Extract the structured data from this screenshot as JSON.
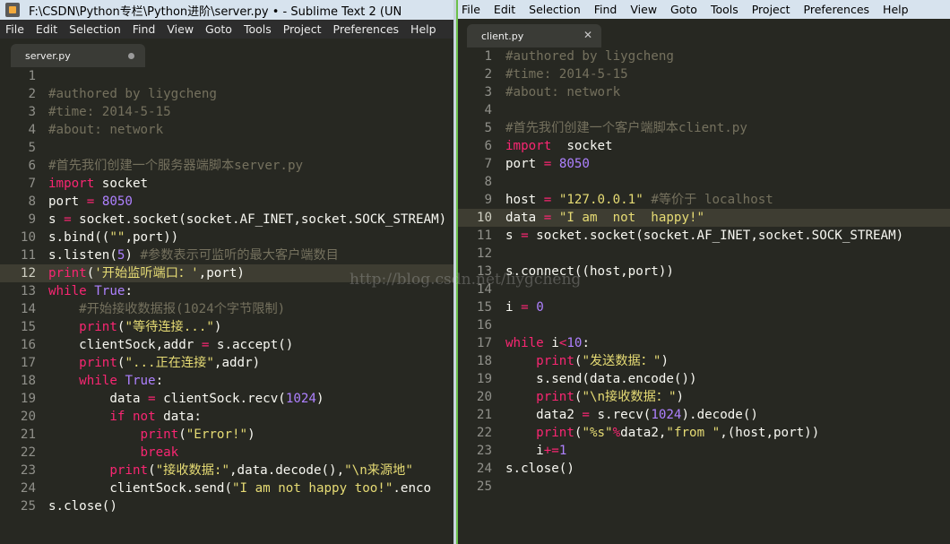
{
  "left_window": {
    "title": "F:\\CSDN\\Python专栏\\Python进阶\\server.py • - Sublime Text 2 (UN",
    "menu": [
      "File",
      "Edit",
      "Selection",
      "Find",
      "View",
      "Goto",
      "Tools",
      "Project",
      "Preferences",
      "Help"
    ],
    "tab": {
      "name": "server.py",
      "state": "unsaved"
    },
    "current_line": 12,
    "lines": [
      [],
      [
        [
          "c",
          "#authored by liygcheng"
        ]
      ],
      [
        [
          "c",
          "#time: 2014-5-15"
        ]
      ],
      [
        [
          "c",
          "#about: network"
        ]
      ],
      [],
      [
        [
          "c",
          "#首先我们创建一个服务器端脚本server.py"
        ]
      ],
      [
        [
          "k",
          "import"
        ],
        [
          "w",
          " socket"
        ]
      ],
      [
        [
          "w",
          "port "
        ],
        [
          "k",
          "="
        ],
        [
          "w",
          " "
        ],
        [
          "n",
          "8050"
        ]
      ],
      [
        [
          "w",
          "s "
        ],
        [
          "k",
          "="
        ],
        [
          "w",
          " socket.socket(socket.AF_INET,socket.SOCK_STREAM)"
        ]
      ],
      [
        [
          "w",
          "s.bind(("
        ],
        [
          "s",
          "\"\""
        ],
        [
          "w",
          ",port))"
        ]
      ],
      [
        [
          "w",
          "s.listen("
        ],
        [
          "n",
          "5"
        ],
        [
          "w",
          ") "
        ],
        [
          "c",
          "#参数表示可监听的最大客户端数目"
        ]
      ],
      [
        [
          "k",
          "print"
        ],
        [
          "w",
          "("
        ],
        [
          "s",
          "'开始监听端口：'"
        ],
        [
          "w",
          ",port)"
        ]
      ],
      [
        [
          "k",
          "while"
        ],
        [
          "w",
          " "
        ],
        [
          "n",
          "True"
        ],
        [
          "w",
          ":"
        ]
      ],
      [
        [
          "w",
          "    "
        ],
        [
          "c",
          "#开始接收数据报(1024个字节限制)"
        ]
      ],
      [
        [
          "w",
          "    "
        ],
        [
          "k",
          "print"
        ],
        [
          "w",
          "("
        ],
        [
          "s",
          "\"等待连接...\""
        ],
        [
          "w",
          ")"
        ]
      ],
      [
        [
          "w",
          "    clientSock,addr "
        ],
        [
          "k",
          "="
        ],
        [
          "w",
          " s.accept()"
        ]
      ],
      [
        [
          "w",
          "    "
        ],
        [
          "k",
          "print"
        ],
        [
          "w",
          "("
        ],
        [
          "s",
          "\"...正在连接\""
        ],
        [
          "w",
          ",addr)"
        ]
      ],
      [
        [
          "w",
          "    "
        ],
        [
          "k",
          "while"
        ],
        [
          "w",
          " "
        ],
        [
          "n",
          "True"
        ],
        [
          "w",
          ":"
        ]
      ],
      [
        [
          "w",
          "        data "
        ],
        [
          "k",
          "="
        ],
        [
          "w",
          " clientSock.recv("
        ],
        [
          "n",
          "1024"
        ],
        [
          "w",
          ")"
        ]
      ],
      [
        [
          "w",
          "        "
        ],
        [
          "k",
          "if"
        ],
        [
          "w",
          " "
        ],
        [
          "k",
          "not"
        ],
        [
          "w",
          " data:"
        ]
      ],
      [
        [
          "w",
          "            "
        ],
        [
          "k",
          "print"
        ],
        [
          "w",
          "("
        ],
        [
          "s",
          "\"Error!\""
        ],
        [
          "w",
          ")"
        ]
      ],
      [
        [
          "w",
          "            "
        ],
        [
          "k",
          "break"
        ]
      ],
      [
        [
          "w",
          "        "
        ],
        [
          "k",
          "print"
        ],
        [
          "w",
          "("
        ],
        [
          "s",
          "\"接收数据:\""
        ],
        [
          "w",
          ",data.decode(),"
        ],
        [
          "s",
          "\"\\n来源地\""
        ]
      ],
      [
        [
          "w",
          "        clientSock.send("
        ],
        [
          "s",
          "\"I am not happy too!\""
        ],
        [
          "w",
          ".enco"
        ]
      ],
      [
        [
          "w",
          "s.close()"
        ]
      ]
    ]
  },
  "right_window": {
    "menu": [
      "File",
      "Edit",
      "Selection",
      "Find",
      "View",
      "Goto",
      "Tools",
      "Project",
      "Preferences",
      "Help"
    ],
    "tab": {
      "name": "client.py",
      "state": "saved"
    },
    "current_line": 10,
    "lines": [
      [
        [
          "c",
          "#authored by liygcheng"
        ]
      ],
      [
        [
          "c",
          "#time: 2014-5-15"
        ]
      ],
      [
        [
          "c",
          "#about: network"
        ]
      ],
      [],
      [
        [
          "c",
          "#首先我们创建一个客户端脚本client.py"
        ]
      ],
      [
        [
          "k",
          "import"
        ],
        [
          "w",
          "  socket"
        ]
      ],
      [
        [
          "w",
          "port "
        ],
        [
          "k",
          "="
        ],
        [
          "w",
          " "
        ],
        [
          "n",
          "8050"
        ]
      ],
      [],
      [
        [
          "w",
          "host "
        ],
        [
          "k",
          "="
        ],
        [
          "w",
          " "
        ],
        [
          "s",
          "\"127.0.0.1\""
        ],
        [
          "w",
          " "
        ],
        [
          "c",
          "#等价于 localhost"
        ]
      ],
      [
        [
          "w",
          "data "
        ],
        [
          "k",
          "="
        ],
        [
          "w",
          " "
        ],
        [
          "s",
          "\"I am  not  happy!\""
        ]
      ],
      [
        [
          "w",
          "s "
        ],
        [
          "k",
          "="
        ],
        [
          "w",
          " socket.socket(socket.AF_INET,socket.SOCK_STREAM)"
        ]
      ],
      [],
      [
        [
          "w",
          "s.connect((host,port))"
        ]
      ],
      [],
      [
        [
          "w",
          "i "
        ],
        [
          "k",
          "="
        ],
        [
          "w",
          " "
        ],
        [
          "n",
          "0"
        ]
      ],
      [],
      [
        [
          "k",
          "while"
        ],
        [
          "w",
          " i"
        ],
        [
          "k",
          "<"
        ],
        [
          "n",
          "10"
        ],
        [
          "w",
          ":"
        ]
      ],
      [
        [
          "w",
          "    "
        ],
        [
          "k",
          "print"
        ],
        [
          "w",
          "("
        ],
        [
          "s",
          "\"发送数据：\""
        ],
        [
          "w",
          ")"
        ]
      ],
      [
        [
          "w",
          "    s.send(data.encode())"
        ]
      ],
      [
        [
          "w",
          "    "
        ],
        [
          "k",
          "print"
        ],
        [
          "w",
          "("
        ],
        [
          "s",
          "\"\\n接收数据：\""
        ],
        [
          "w",
          ")"
        ]
      ],
      [
        [
          "w",
          "    data2 "
        ],
        [
          "k",
          "="
        ],
        [
          "w",
          " s.recv("
        ],
        [
          "n",
          "1024"
        ],
        [
          "w",
          ").decode()"
        ]
      ],
      [
        [
          "w",
          "    "
        ],
        [
          "k",
          "print"
        ],
        [
          "w",
          "("
        ],
        [
          "s",
          "\"%s\""
        ],
        [
          "k",
          "%"
        ],
        [
          "w",
          "data2,"
        ],
        [
          "s",
          "\"from \""
        ],
        [
          "w",
          ",(host,port))"
        ]
      ],
      [
        [
          "w",
          "    i"
        ],
        [
          "k",
          "+="
        ],
        [
          "n",
          "1"
        ]
      ],
      [
        [
          "w",
          "s.close()"
        ]
      ],
      []
    ]
  },
  "watermark": "http://blog.csdn.net/liygcheng",
  "colors": {
    "background": "#272822",
    "comment": "#75715e",
    "keyword": "#f92672",
    "string": "#e6db74",
    "number": "#ae81ff",
    "text": "#f8f8f2",
    "gutter": "#90908a",
    "current_line": "#3e3d32"
  }
}
